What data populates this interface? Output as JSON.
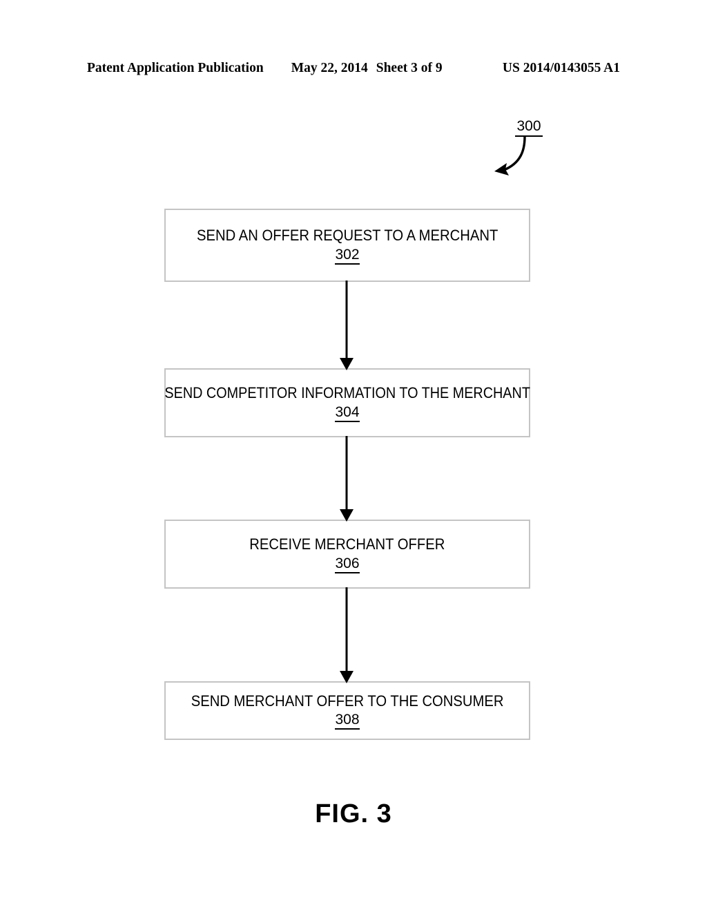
{
  "header": {
    "publication": "Patent Application Publication",
    "date": "May 22, 2014",
    "sheet": "Sheet 3 of 9",
    "patent_number": "US 2014/0143055 A1"
  },
  "figure": {
    "reference_label": "300",
    "caption": "FIG. 3",
    "steps": [
      {
        "text": "SEND AN OFFER REQUEST TO A MERCHANT",
        "number": "302"
      },
      {
        "text": "SEND COMPETITOR INFORMATION TO THE MERCHANT",
        "number": "304"
      },
      {
        "text": "RECEIVE MERCHANT OFFER",
        "number": "306"
      },
      {
        "text": "SEND MERCHANT OFFER TO THE CONSUMER",
        "number": "308"
      }
    ],
    "connectors": [
      {
        "from": "302",
        "to": "304"
      },
      {
        "from": "304",
        "to": "306"
      },
      {
        "from": "306",
        "to": "308"
      }
    ],
    "colors": {
      "box_border": "#c4c4c4",
      "ink": "#000000",
      "background": "#ffffff"
    }
  }
}
